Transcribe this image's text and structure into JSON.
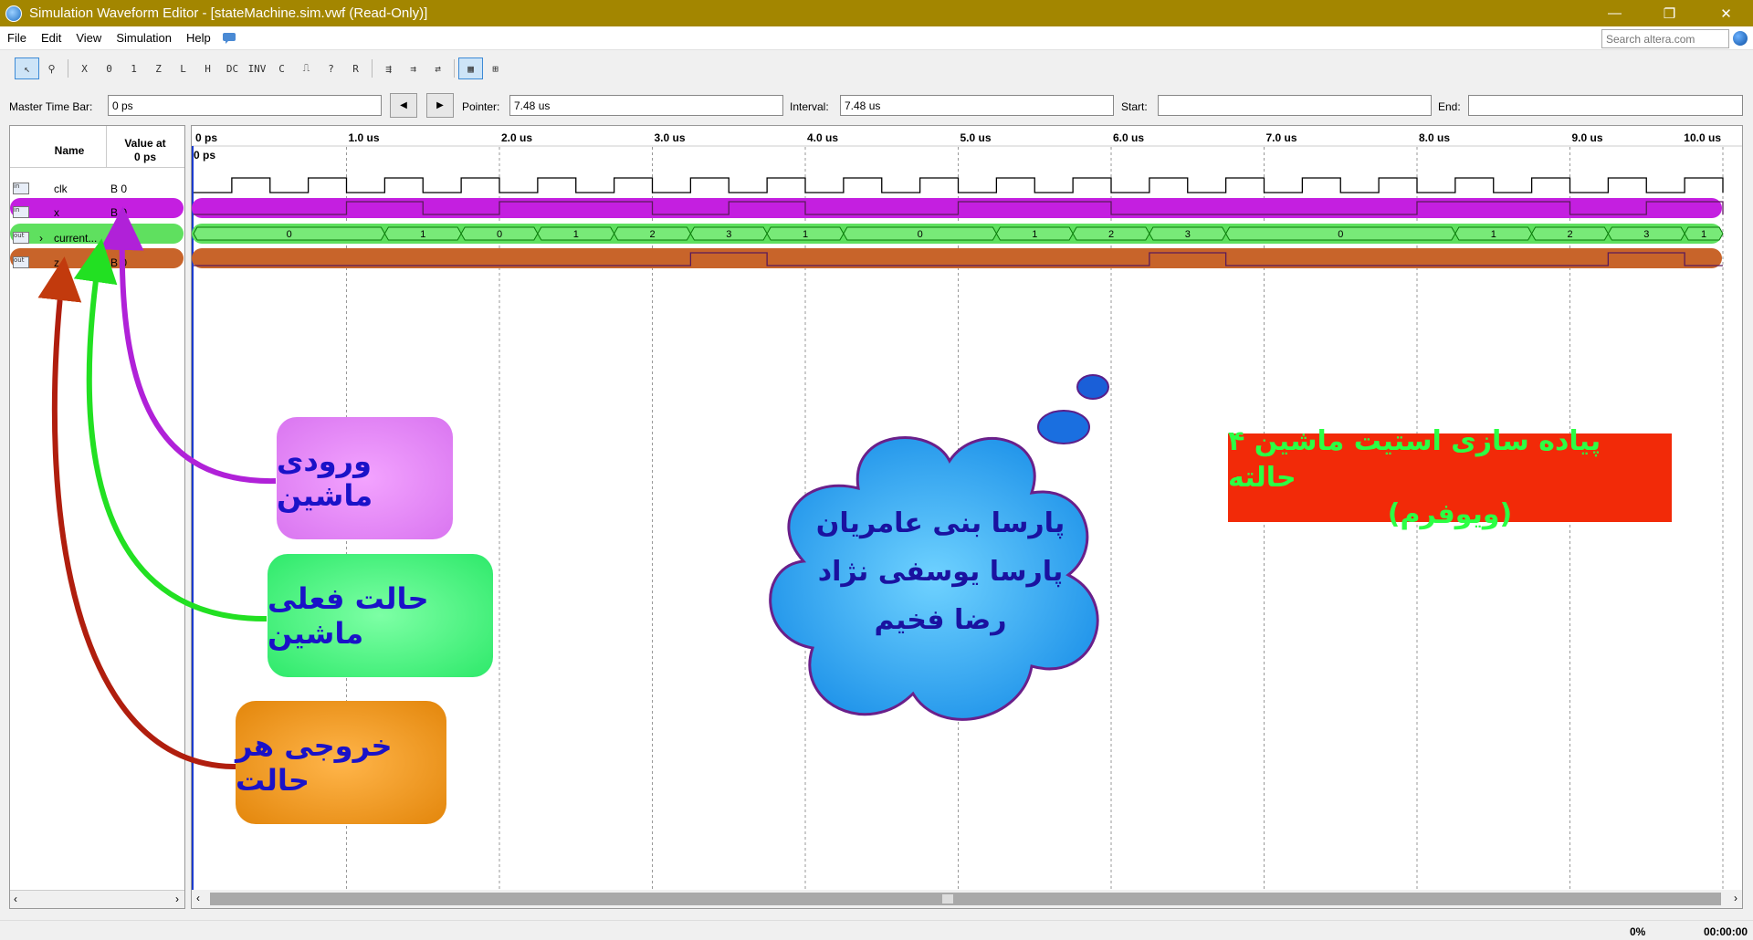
{
  "window": {
    "title": "Simulation Waveform Editor - [stateMachine.sim.vwf (Read-Only)]"
  },
  "menu": {
    "items": [
      "File",
      "Edit",
      "View",
      "Simulation",
      "Help"
    ],
    "search_placeholder": "Search altera.com"
  },
  "toolbar": {
    "buttons": [
      "select-icon",
      "zoom-icon",
      "forcing-unknown-icon",
      "forcing-low-icon",
      "forcing-high-icon",
      "high-impedance-icon",
      "weak-low-icon",
      "weak-high-icon",
      "dont-care-icon",
      "invert-icon",
      "count-value-icon",
      "clock-icon",
      "arbitrary-value-icon",
      "random-value-icon",
      "functional-sim-icon",
      "timing-sim-icon",
      "netlist-icon",
      "snap-grid-icon",
      "grid-icon"
    ]
  },
  "timebar": {
    "master_label": "Master Time Bar:",
    "master_value": "0 ps",
    "pointer_label": "Pointer:",
    "pointer_value": "7.48 us",
    "interval_label": "Interval:",
    "interval_value": "7.48 us",
    "start_label": "Start:",
    "start_value": "",
    "end_label": "End:",
    "end_value": ""
  },
  "columns": {
    "name": "Name",
    "value_line1": "Value at",
    "value_line2": "0 ps"
  },
  "time_axis": {
    "labels": [
      "0 ps",
      "1.0 us",
      "2.0 us",
      "3.0 us",
      "4.0 us",
      "5.0 us",
      "6.0 us",
      "7.0 us",
      "8.0 us",
      "9.0 us",
      "10.0 us"
    ],
    "cursor_label": "0 ps",
    "max_us": 10.0
  },
  "signals": [
    {
      "name": "clk",
      "type": "in",
      "value": "B 0",
      "expandable": false
    },
    {
      "name": "x",
      "type": "in",
      "value": "B 0",
      "expandable": false
    },
    {
      "name": "current...",
      "type": "out",
      "value": "",
      "expandable": true
    },
    {
      "name": "z",
      "type": "out",
      "value": "B 0",
      "expandable": false
    }
  ],
  "waveforms": {
    "clk_period_us": 0.5,
    "x_high": [
      [
        1.0,
        1.5
      ],
      [
        2.0,
        3.0
      ],
      [
        3.5,
        4.0
      ],
      [
        5.0,
        6.0
      ],
      [
        8.0,
        9.0
      ],
      [
        9.5,
        10.0
      ]
    ],
    "state_segments": [
      {
        "start": 0.0,
        "end": 1.25,
        "value": "0"
      },
      {
        "start": 1.25,
        "end": 1.75,
        "value": "1"
      },
      {
        "start": 1.75,
        "end": 2.25,
        "value": "0"
      },
      {
        "start": 2.25,
        "end": 2.75,
        "value": "1"
      },
      {
        "start": 2.75,
        "end": 3.25,
        "value": "2"
      },
      {
        "start": 3.25,
        "end": 3.75,
        "value": "3"
      },
      {
        "start": 3.75,
        "end": 4.25,
        "value": "1"
      },
      {
        "start": 4.25,
        "end": 5.25,
        "value": "0"
      },
      {
        "start": 5.25,
        "end": 5.75,
        "value": "1"
      },
      {
        "start": 5.75,
        "end": 6.25,
        "value": "2"
      },
      {
        "start": 6.25,
        "end": 6.75,
        "value": "3"
      },
      {
        "start": 6.75,
        "end": 8.25,
        "value": "0"
      },
      {
        "start": 8.25,
        "end": 8.75,
        "value": "1"
      },
      {
        "start": 8.75,
        "end": 9.25,
        "value": "2"
      },
      {
        "start": 9.25,
        "end": 9.75,
        "value": "3"
      },
      {
        "start": 9.75,
        "end": 10.0,
        "value": "1"
      }
    ],
    "z_high": [
      [
        3.25,
        3.75
      ],
      [
        6.25,
        6.75
      ],
      [
        9.25,
        9.75
      ]
    ]
  },
  "annotations": {
    "input_label": "ورودی ماشین",
    "state_label": "حالت فعلی ماشین",
    "output_label": "خروجی هر حالت",
    "cloud_names": [
      "پارسا بنی عامریان",
      "پارسا یوسفی نژاد",
      "رضا فخیم"
    ],
    "title_line1": "پیاده سازی استیت ماشین ۴ حالته",
    "title_line2": "(ویوفرم)"
  },
  "colors": {
    "titlebar": "#a38600",
    "x_highlight": "#c41fe0",
    "state_highlight": "#5fe05f",
    "z_highlight": "#c8642a",
    "input_box": "#e07af0",
    "state_box": "#33ef6c",
    "output_box": "#e58b0c",
    "cloud": "#1b98f0",
    "title_box": "#f22a08",
    "title_text": "#2cff44",
    "annotation_text": "#1a12c8"
  },
  "status": {
    "progress": "0%",
    "elapsed": "00:00:00"
  }
}
